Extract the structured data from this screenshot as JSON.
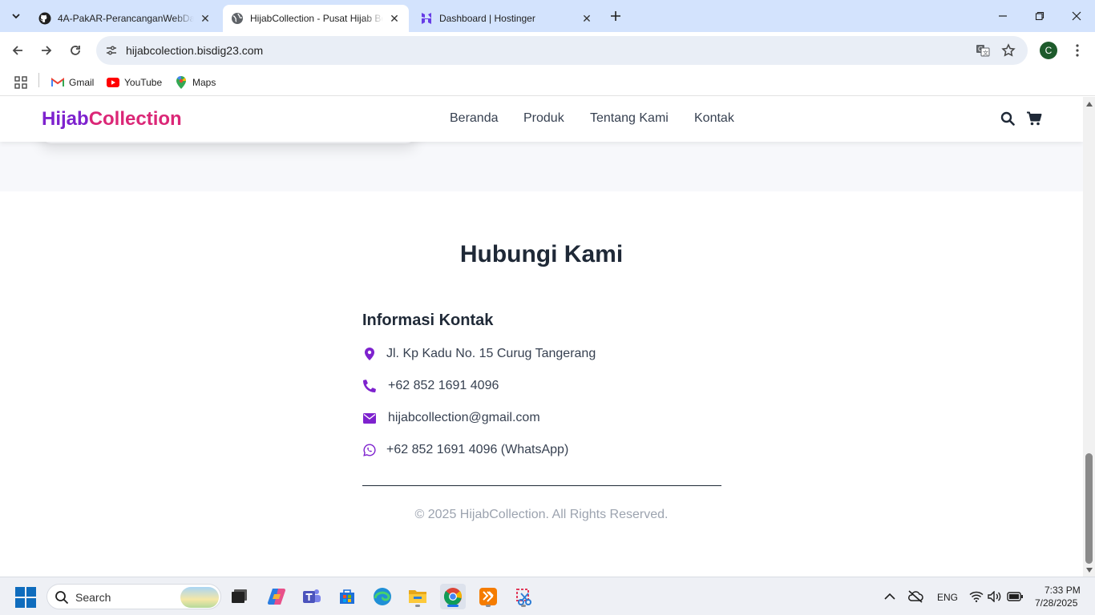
{
  "browser": {
    "tabs": [
      {
        "title": "4A-PakAR-PerancanganWebDan",
        "active": false,
        "icon": "github-icon"
      },
      {
        "title": "HijabCollection - Pusat Hijab Be",
        "active": true,
        "icon": "globe-icon"
      },
      {
        "title": "Dashboard | Hostinger",
        "active": false,
        "icon": "hostinger-icon"
      }
    ],
    "url": "hijabcolection.bisdig23.com",
    "profile_initial": "C",
    "bookmarks": [
      {
        "label": "Gmail",
        "icon": "gmail-icon"
      },
      {
        "label": "YouTube",
        "icon": "youtube-icon"
      },
      {
        "label": "Maps",
        "icon": "maps-icon"
      }
    ]
  },
  "site": {
    "logo_part1": "Hijab",
    "logo_part2": "Collection",
    "nav": [
      "Beranda",
      "Produk",
      "Tentang Kami",
      "Kontak"
    ],
    "contact": {
      "title": "Hubungi Kami",
      "info_heading": "Informasi Kontak",
      "items": [
        {
          "icon": "map-marker-icon",
          "text": "Jl. Kp Kadu No. 15 Curug Tangerang"
        },
        {
          "icon": "phone-icon",
          "text": "+62 852 1691 4096"
        },
        {
          "icon": "envelope-icon",
          "text": "hijabcollection@gmail.com"
        },
        {
          "icon": "whatsapp-icon",
          "text": "+62 852 1691 4096 (WhatsApp)"
        }
      ]
    },
    "copyright": "© 2025 HijabCollection. All Rights Reserved.",
    "colors": {
      "brand_purple": "#7e22ce",
      "brand_pink": "#db2777"
    }
  },
  "taskbar": {
    "search_placeholder": "Search",
    "language": "ENG",
    "time": "7:33 PM",
    "date": "7/28/2025"
  }
}
